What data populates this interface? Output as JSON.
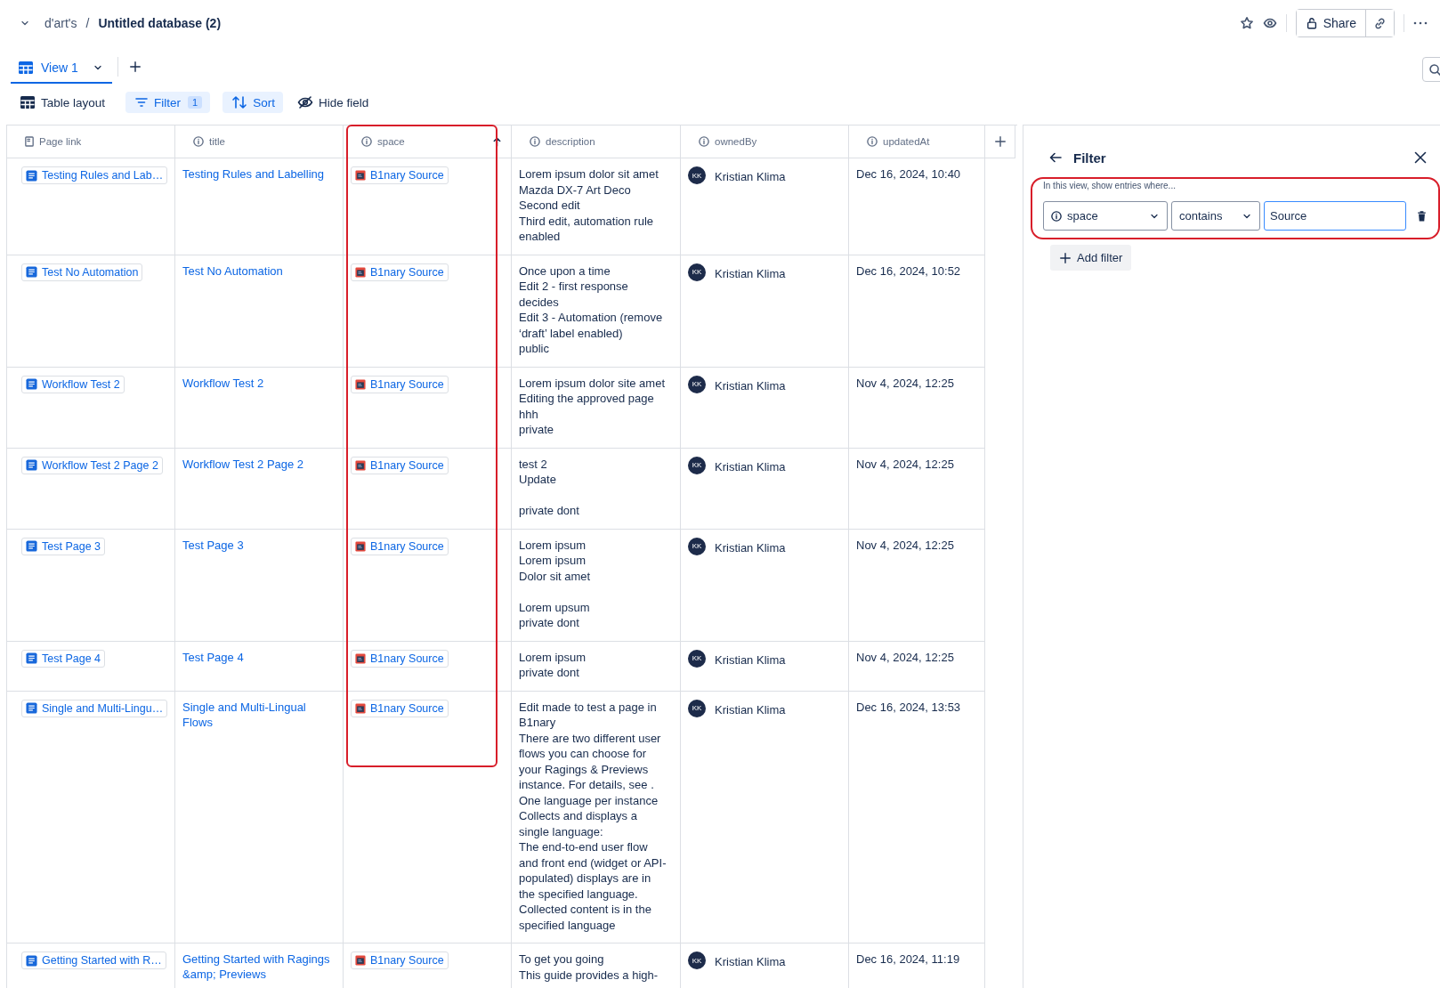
{
  "breadcrumb": {
    "parent": "d'art's",
    "separator": "/",
    "current": "Untitled database (2)"
  },
  "share": {
    "label": "Share"
  },
  "views": [
    {
      "label": "View 1",
      "selected": true
    }
  ],
  "toolbar": [
    {
      "kind": "layout",
      "label": "Table layout",
      "active": false
    },
    {
      "kind": "filter",
      "label": "Filter",
      "count": "1",
      "active": true
    },
    {
      "kind": "sort",
      "label": "Sort",
      "active": true
    },
    {
      "kind": "hide",
      "label": "Hide field",
      "active": false
    }
  ],
  "table": {
    "columns": [
      {
        "label": "Page link",
        "kind": "page"
      },
      {
        "label": "title",
        "kind": "info"
      },
      {
        "label": "space",
        "kind": "info",
        "sort_ascending": true
      },
      {
        "label": "description",
        "kind": "info"
      },
      {
        "label": "ownedBy",
        "kind": "info"
      },
      {
        "label": "updatedAt",
        "kind": "info"
      }
    ],
    "rows": [
      {
        "page_link": "Testing Rules and Lab…",
        "title": "Testing Rules and Labelling",
        "space": "B1nary Source",
        "description": "Lorem ipsum dolor sit amet\nMazda DX-7 Art Deco\nSecond edit\nThird edit, automation rule enabled",
        "owner_initials": "KK",
        "owner": "Kristian Klima",
        "updated": "Dec 16, 2024, 10:40"
      },
      {
        "page_link": "Test No Automation",
        "title": "Test No Automation",
        "space": "B1nary Source",
        "description": "Once upon a time\nEdit 2 - first response decides\nEdit 3 - Automation (remove ‘draft’ label enabled)\npublic",
        "owner_initials": "KK",
        "owner": "Kristian Klima",
        "updated": "Dec 16, 2024, 10:52"
      },
      {
        "page_link": "Workflow Test 2",
        "title": "Workflow Test 2",
        "space": "B1nary Source",
        "description": "Lorem ipsum dolor site amet\nEditing the approved page\nhhh\nprivate",
        "owner_initials": "KK",
        "owner": "Kristian Klima",
        "updated": "Nov 4, 2024, 12:25"
      },
      {
        "page_link": "Workflow Test 2 Page 2",
        "title": "Workflow Test 2 Page 2",
        "space": "B1nary Source",
        "description": "test 2\nUpdate\n\nprivate dont",
        "owner_initials": "KK",
        "owner": "Kristian Klima",
        "updated": "Nov 4, 2024, 12:25"
      },
      {
        "page_link": "Test Page 3",
        "title": "Test Page 3",
        "space": "B1nary Source",
        "description": "Lorem ipsum\nLorem ipsum\nDolor sit amet\n\nLorem upsum\nprivate dont",
        "owner_initials": "KK",
        "owner": "Kristian Klima",
        "updated": "Nov 4, 2024, 12:25"
      },
      {
        "page_link": "Test Page 4",
        "title": "Test Page 4",
        "space": "B1nary Source",
        "description": "Lorem ipsum\nprivate dont",
        "owner_initials": "KK",
        "owner": "Kristian Klima",
        "updated": "Nov 4, 2024, 12:25"
      },
      {
        "page_link": "Single and Multi-Lingu…",
        "title": "Single and Multi-Lingual Flows",
        "space": "B1nary Source",
        "description": "Edit made to test a page in B1nary\nThere are two different user flows you can choose for your Ragings & Previews instance. For details, see .\nOne language per instance\nCollects and displays a single language:\nThe end-to-end user flow and front end (widget or API-populated) displays are in the specified language.\nCollected content is in the specified language",
        "owner_initials": "KK",
        "owner": "Kristian Klima",
        "updated": "Dec 16, 2024, 13:53"
      },
      {
        "page_link": "Getting Started with R…",
        "title": "Getting Started with Ragings &amp; Previews",
        "space": "B1nary Source",
        "description": "To get you going\nThis guide provides a high-",
        "owner_initials": "KK",
        "owner": "Kristian Klima",
        "updated": "Dec 16, 2024, 11:19"
      }
    ]
  },
  "filter_panel": {
    "title": "Filter",
    "hint": "In this view, show entries where...",
    "rules": [
      {
        "field": "space",
        "operator": "contains",
        "value": "Source"
      }
    ],
    "add_label": "Add filter"
  }
}
